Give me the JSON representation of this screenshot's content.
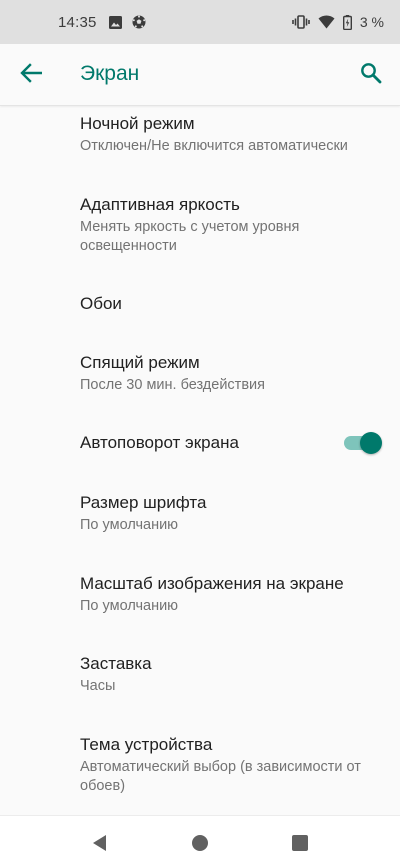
{
  "status_bar": {
    "time": "14:35",
    "battery_percent": "3 %",
    "icons": [
      "image-icon",
      "soccer-ball-icon",
      "vibrate-icon",
      "wifi-icon",
      "battery-charging-icon"
    ]
  },
  "app_bar": {
    "title": "Экран",
    "back_icon": "arrow-back-icon",
    "search_icon": "search-icon",
    "accent_color": "#00796b"
  },
  "settings": {
    "items": [
      {
        "title": "Ночной режим",
        "summary": "Отключен/Не включится автоматически"
      },
      {
        "title": "Адаптивная яркость",
        "summary": "Менять яркость с учетом уровня освещенности"
      },
      {
        "title": "Обои",
        "summary": ""
      },
      {
        "title": "Спящий режим",
        "summary": "После 30 мин. бездействия"
      },
      {
        "title": "Автоповорот экрана",
        "summary": "",
        "toggle_on": true
      },
      {
        "title": "Размер шрифта",
        "summary": "По умолчанию"
      },
      {
        "title": "Масштаб изображения на экране",
        "summary": "По умолчанию"
      },
      {
        "title": "Заставка",
        "summary": "Часы"
      },
      {
        "title": "Тема устройства",
        "summary": "Автоматический выбор (в зависимости от обоев)"
      }
    ]
  },
  "nav_bar": {
    "icons": [
      "nav-back-icon",
      "nav-home-icon",
      "nav-recents-icon"
    ]
  }
}
